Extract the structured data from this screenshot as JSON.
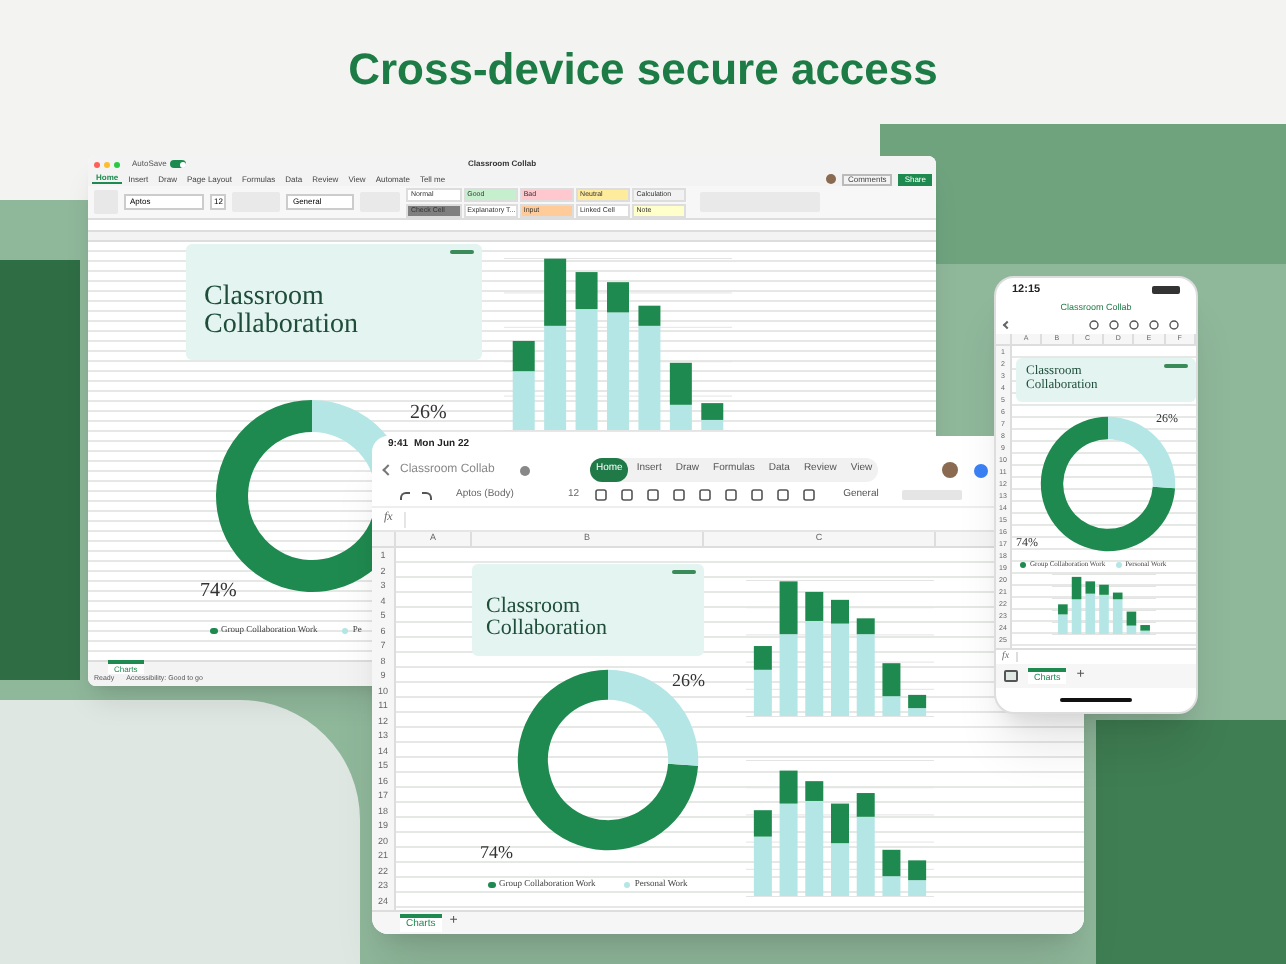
{
  "headline": "Cross-device secure access",
  "desktop": {
    "autosave": "AutoSave",
    "autosave_on": true,
    "title": "Classroom Collab",
    "ribbon_tabs": [
      {
        "label": "Home",
        "selected": true
      },
      {
        "label": "Insert",
        "selected": false
      },
      {
        "label": "Draw",
        "selected": false
      },
      {
        "label": "Page Layout",
        "selected": false
      },
      {
        "label": "Formulas",
        "selected": false
      },
      {
        "label": "Data",
        "selected": false
      },
      {
        "label": "Review",
        "selected": false
      },
      {
        "label": "View",
        "selected": false
      },
      {
        "label": "Automate",
        "selected": false
      },
      {
        "label": "Tell me",
        "selected": false
      }
    ],
    "comments": "Comments",
    "share": "Share",
    "font": "Aptos",
    "font_size": "12",
    "number_format": "General",
    "styles": [
      {
        "label": "Normal",
        "color": "#ffffff"
      },
      {
        "label": "Good",
        "color": "#c6efce"
      },
      {
        "label": "Bad",
        "color": "#ffc7ce"
      },
      {
        "label": "Neutral",
        "color": "#ffeb9c"
      },
      {
        "label": "Calculation",
        "color": "#f2f2f2"
      },
      {
        "label": "Check Cell",
        "color": "#7f7f7f"
      },
      {
        "label": "Explanatory T...",
        "color": "#ffffff"
      },
      {
        "label": "Input",
        "color": "#ffcc99"
      },
      {
        "label": "Linked Cell",
        "color": "#ffffff"
      },
      {
        "label": "Note",
        "color": "#ffffcc"
      }
    ],
    "card_title": "Classroom Collaboration",
    "chart_data": {
      "type": "donut",
      "categories": [
        "Group Collaboration Work",
        "Pe"
      ],
      "values": [
        74,
        26
      ],
      "value_labels": [
        "74%",
        "26%"
      ],
      "legend": "bottom"
    },
    "sheet_tabs": [
      {
        "label": "Charts",
        "selected": true
      }
    ],
    "status": "Ready",
    "accessibility": "Accessibility: Good to go"
  },
  "tablet": {
    "time": "9:41",
    "date": "Mon Jun 22",
    "title": "Classroom Collab",
    "tabs": [
      {
        "label": "Home",
        "selected": true
      },
      {
        "label": "Insert",
        "selected": false
      },
      {
        "label": "Draw",
        "selected": false
      },
      {
        "label": "Formulas",
        "selected": false
      },
      {
        "label": "Data",
        "selected": false
      },
      {
        "label": "Review",
        "selected": false
      },
      {
        "label": "View",
        "selected": false
      }
    ],
    "font": "Aptos (Body)",
    "font_size": "12",
    "number_format": "General",
    "formula_label": "fx",
    "columns": [
      "A",
      "B",
      "C"
    ],
    "rows": [
      "1",
      "2",
      "3",
      "4",
      "5",
      "6",
      "7",
      "8",
      "9",
      "10",
      "11",
      "12",
      "13",
      "14",
      "15",
      "16",
      "17",
      "18",
      "19",
      "20",
      "21",
      "22",
      "23",
      "24"
    ],
    "card_title": "Classroom Collaboration",
    "chart_data": {
      "type": "donut",
      "categories": [
        "Group Collaboration Work",
        "Personal Work"
      ],
      "values": [
        74,
        26
      ],
      "value_labels": [
        "74%",
        "26%"
      ],
      "legend": "bottom"
    },
    "sheet_tabs": [
      {
        "label": "Charts",
        "selected": true
      }
    ],
    "add_sheet": "+"
  },
  "phone": {
    "time": "12:15",
    "title": "Classroom Collab",
    "formula_label": "fx",
    "columns": [
      "A",
      "B",
      "C",
      "D",
      "E",
      "F"
    ],
    "rows": [
      "1",
      "2",
      "3",
      "4",
      "5",
      "6",
      "7",
      "8",
      "9",
      "10",
      "11",
      "12",
      "13",
      "14",
      "15",
      "16",
      "17",
      "18",
      "19",
      "20",
      "21",
      "22",
      "23",
      "24",
      "25"
    ],
    "card_title": "Classroom Collaboration",
    "chart_data": {
      "type": "donut",
      "categories": [
        "Group Collaboration Work",
        "Personal Work"
      ],
      "values": [
        74,
        26
      ],
      "value_labels": [
        "74%",
        "26%"
      ],
      "legend": "bottom"
    },
    "sheet_tabs": [
      {
        "label": "Charts",
        "selected": true
      }
    ],
    "add_sheet": "+"
  }
}
